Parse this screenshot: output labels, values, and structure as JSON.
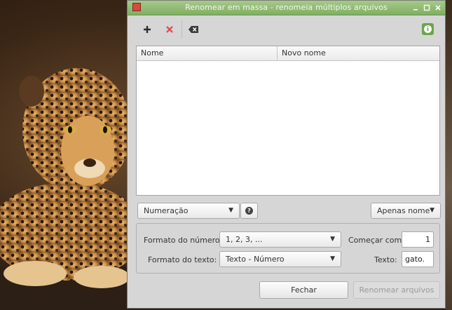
{
  "window": {
    "title": "Renomear em massa - renomeia múltiplos arquivos"
  },
  "toolbar": {
    "add_icon": "plus-icon",
    "remove_icon": "x-icon",
    "clear_icon": "backspace-icon",
    "info_icon": "info-icon"
  },
  "list": {
    "columns": [
      "Nome",
      "Novo nome"
    ],
    "rows": []
  },
  "controls": {
    "mode": "Numeração",
    "scope": "Apenas nome"
  },
  "options": {
    "number_format_label": "Formato do número:",
    "number_format_value": "1, 2, 3, ...",
    "text_format_label": "Formato do texto:",
    "text_format_value": "Texto - Número",
    "start_label": "Começar com:",
    "start_value": "1",
    "text_label": "Texto:",
    "text_value": "gato."
  },
  "buttons": {
    "close": "Fechar",
    "rename": "Renomear arquivos"
  },
  "colors": {
    "titlebar": "#7fb062",
    "window_bg": "#d6d6d6",
    "remove_icon": "#e05050"
  }
}
